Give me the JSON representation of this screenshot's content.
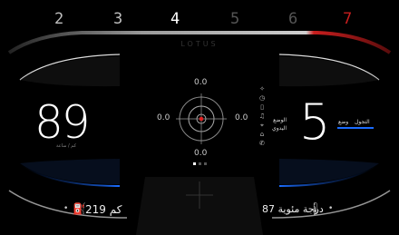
{
  "gears": {
    "items": [
      {
        "label": "2",
        "state": "normal"
      },
      {
        "label": "3",
        "state": "normal"
      },
      {
        "label": "4",
        "state": "active"
      },
      {
        "label": "5",
        "state": "dim"
      },
      {
        "label": "6",
        "state": "dim"
      },
      {
        "label": "7",
        "state": "red"
      }
    ]
  },
  "brand": "LOTUS",
  "speed": {
    "value": "89",
    "unit": "كم / ساعة"
  },
  "drive": {
    "gear": "5",
    "label_line1": "الوضع",
    "label_line2": "اليدوي"
  },
  "modes": {
    "tab1": "وضع",
    "tab2": "التجول"
  },
  "g_meter": {
    "top": "0.0",
    "left": "0.0",
    "right": "0.0",
    "bottom": "0.0"
  },
  "fuel": {
    "text": "219 كم",
    "icon": "fuel-pump-icon"
  },
  "temperature": {
    "text": "87 درجة مئوية",
    "icon": "coolant-temp-icon"
  },
  "colors": {
    "accent_blue": "#1a6cff",
    "redline": "#c81e1e",
    "target_red": "#e02020"
  }
}
